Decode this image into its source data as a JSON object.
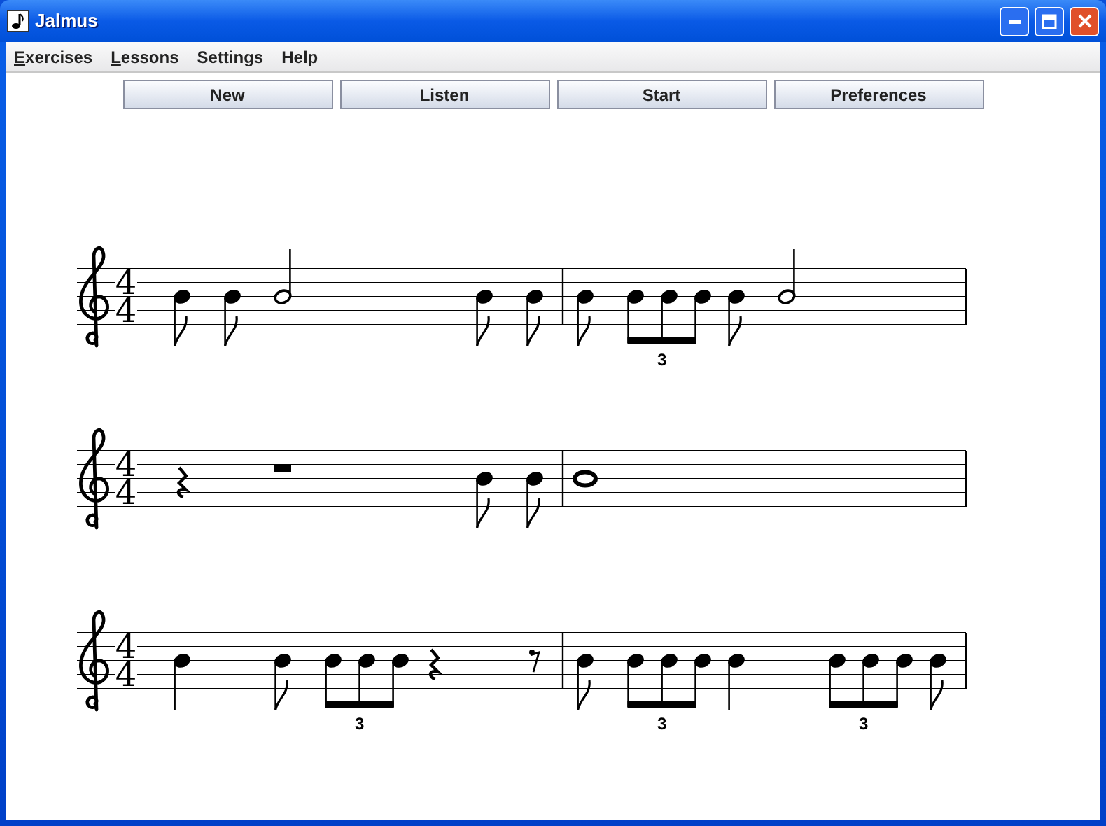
{
  "window": {
    "title": "Jalmus"
  },
  "menu": [
    {
      "label": "Exercises",
      "mnemonic": true
    },
    {
      "label": "Lessons",
      "mnemonic": true
    },
    {
      "label": "Settings",
      "mnemonic": false
    },
    {
      "label": "Help",
      "mnemonic": false
    }
  ],
  "toolbar": [
    "New",
    "Listen",
    "Start",
    "Preferences"
  ],
  "staves": [
    {
      "time_signature": [
        "4",
        "4"
      ],
      "measures": [
        [
          {
            "kind": "eighth"
          },
          {
            "kind": "eighth"
          },
          {
            "kind": "half"
          },
          {
            "kind": "eighth"
          },
          {
            "kind": "eighth"
          }
        ],
        [
          {
            "kind": "eighth"
          },
          {
            "kind": "triplet",
            "label": "3",
            "notes": [
              {
                "kind": "eighth"
              },
              {
                "kind": "eighth"
              },
              {
                "kind": "eighth"
              }
            ]
          },
          {
            "kind": "eighth"
          },
          {
            "kind": "half"
          }
        ]
      ]
    },
    {
      "time_signature": [
        "4",
        "4"
      ],
      "measures": [
        [
          {
            "kind": "quarter_rest"
          },
          {
            "kind": "half_rest"
          },
          {
            "kind": "eighth"
          },
          {
            "kind": "eighth"
          }
        ],
        [
          {
            "kind": "whole"
          }
        ]
      ]
    },
    {
      "time_signature": [
        "4",
        "4"
      ],
      "measures": [
        [
          {
            "kind": "quarter"
          },
          {
            "kind": "eighth"
          },
          {
            "kind": "triplet",
            "label": "3",
            "notes": [
              {
                "kind": "eighth"
              },
              {
                "kind": "eighth"
              },
              {
                "kind": "eighth"
              }
            ]
          },
          {
            "kind": "quarter_rest"
          },
          {
            "kind": "eighth_rest"
          }
        ],
        [
          {
            "kind": "eighth"
          },
          {
            "kind": "triplet",
            "label": "3",
            "notes": [
              {
                "kind": "eighth"
              },
              {
                "kind": "eighth"
              },
              {
                "kind": "eighth"
              }
            ]
          },
          {
            "kind": "quarter"
          },
          {
            "kind": "triplet",
            "label": "3",
            "notes": [
              {
                "kind": "eighth"
              },
              {
                "kind": "eighth"
              },
              {
                "kind": "eighth"
              }
            ]
          },
          {
            "kind": "eighth"
          }
        ]
      ]
    }
  ]
}
